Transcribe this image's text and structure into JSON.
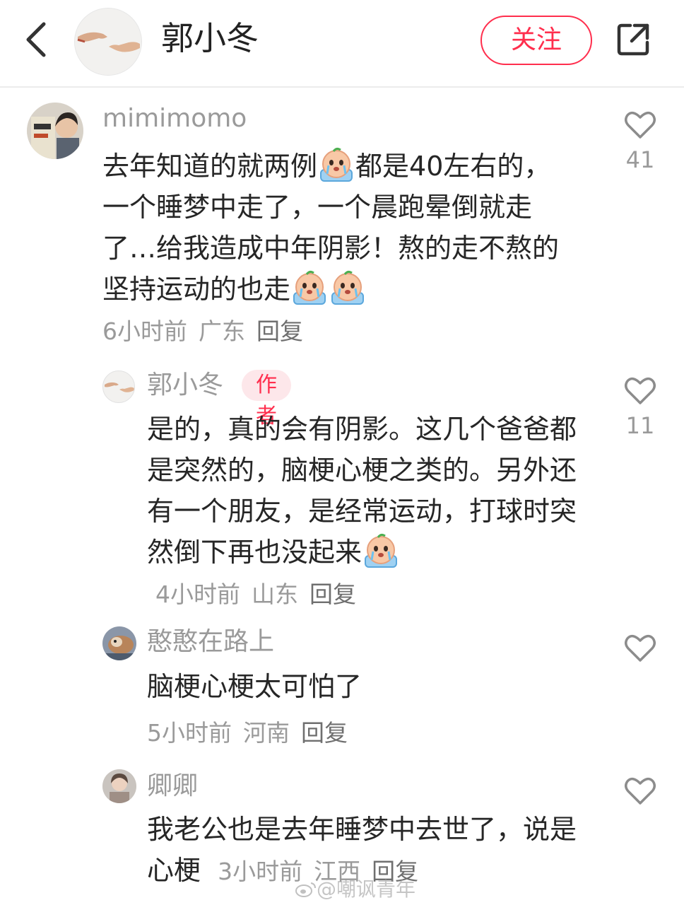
{
  "header": {
    "name": "郭小冬",
    "follow_label": "关注"
  },
  "comments": [
    {
      "username": "mimimomo",
      "text_parts": [
        "去年知道的就两例",
        "都是40左右的，一个睡梦中走了，一个晨跑晕倒就走了…给我造成中年阴影！熬的走不熬的坚持运动的也走"
      ],
      "time": "6小时前",
      "location": "广东",
      "reply": "回复",
      "likes": "41"
    },
    {
      "username": "郭小冬",
      "badge": "作者",
      "text": "是的，真的会有阴影。这几个爸爸都是突然的，脑梗心梗之类的。另外还有一个朋友，是经常运动，打球时突然倒下再也没起来",
      "time": "4小时前",
      "location": "山东",
      "reply": "回复",
      "likes": "11"
    },
    {
      "username": "憨憨在路上",
      "text": "脑梗心梗太可怕了",
      "time": "5小时前",
      "location": "河南",
      "reply": "回复"
    },
    {
      "username": "卿卿",
      "text": "我老公也是去年睡梦中去世了，说是心梗",
      "time": "3小时前",
      "location": "江西",
      "reply": "回复"
    }
  ],
  "watermark": "@嘲讽青年",
  "icons": {
    "back": "chevron-left-icon",
    "share": "share-icon",
    "like": "heart-outline-icon",
    "emoji": "crying-face-emoji"
  },
  "colors": {
    "accent": "#ff2e4d",
    "muted": "#9a9a9a",
    "text": "#262626"
  }
}
